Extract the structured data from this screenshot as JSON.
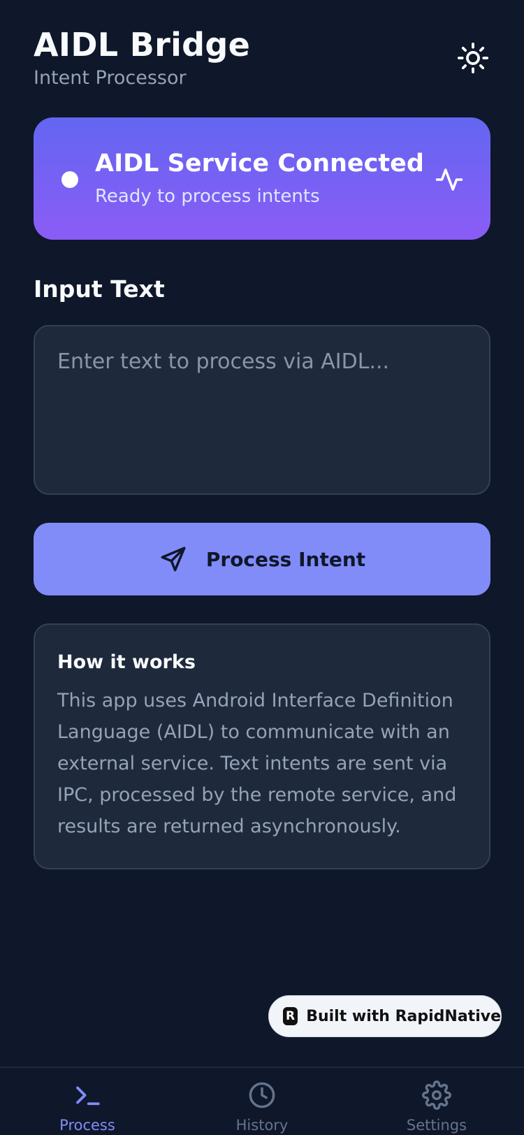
{
  "header": {
    "title": "AIDL Bridge",
    "subtitle": "Intent Processor",
    "theme_icon": "sun-icon"
  },
  "status": {
    "title": "AIDL Service Connected",
    "subtitle": "Ready to process intents",
    "icon": "activity-icon",
    "gradient_start": "#6366f1",
    "gradient_end": "#8b5cf6"
  },
  "input": {
    "label": "Input Text",
    "value": "",
    "placeholder": "Enter text to process via AIDL..."
  },
  "process_button": {
    "label": "Process Intent",
    "icon": "send-icon",
    "color": "#818cf8"
  },
  "info": {
    "title": "How it works",
    "body": "This app uses Android Interface Definition Language (AIDL) to communicate with an external service. Text intents are sent via IPC, processed by the remote service, and results are returned asynchronously."
  },
  "badge": {
    "logo": "R",
    "text": "Built with RapidNative"
  },
  "tabs": [
    {
      "label": "Process",
      "icon": "terminal-icon",
      "active": true
    },
    {
      "label": "History",
      "icon": "clock-icon",
      "active": false
    },
    {
      "label": "Settings",
      "icon": "gear-icon",
      "active": false
    }
  ],
  "colors": {
    "background": "#0f172a",
    "surface": "#1e293b",
    "accent": "#818cf8",
    "muted": "#94a3b8"
  }
}
